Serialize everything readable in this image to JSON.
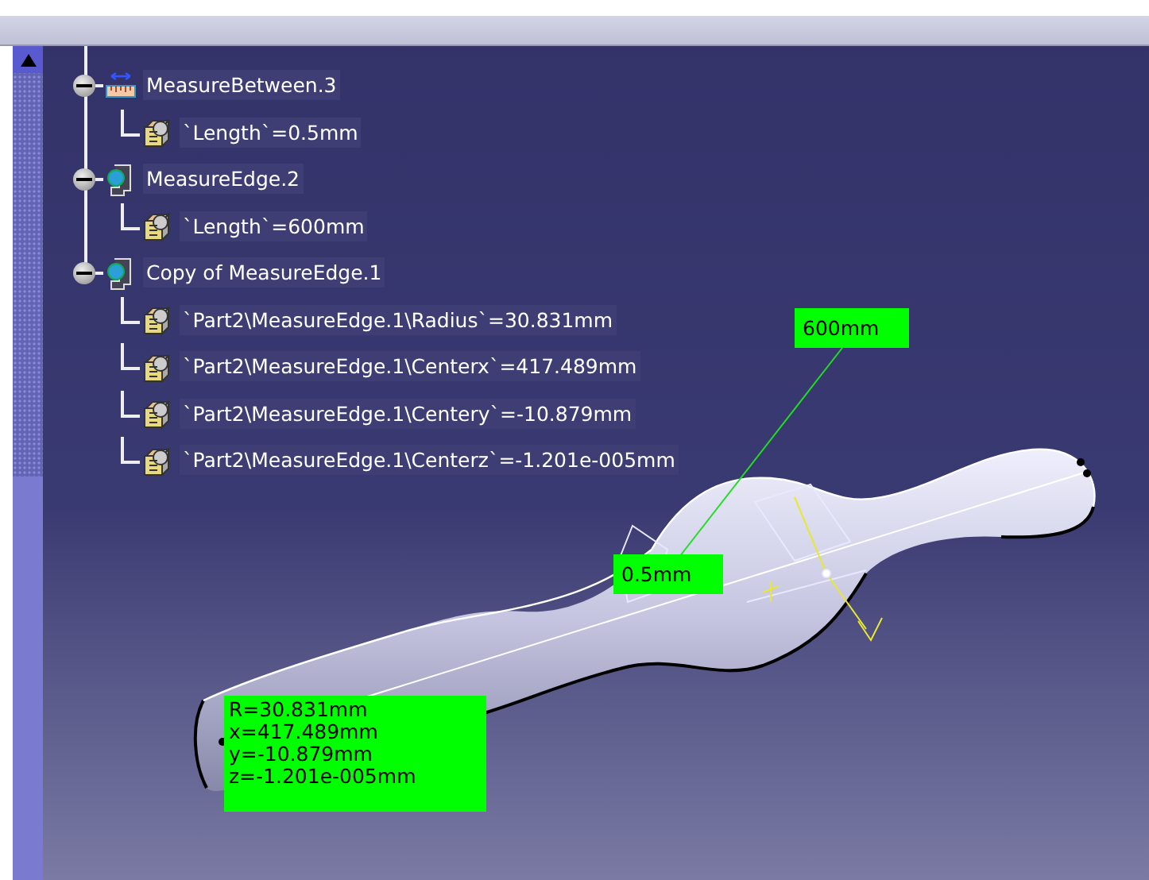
{
  "tree": [
    {
      "label": "MeasureBetween.3",
      "kind": "measure-between",
      "expanded": true,
      "children": [
        {
          "label": "`Length`=0.5mm"
        }
      ]
    },
    {
      "label": "MeasureEdge.2",
      "kind": "measure-edge",
      "expanded": true,
      "children": [
        {
          "label": "`Length`=600mm"
        }
      ]
    },
    {
      "label": "Copy of MeasureEdge.1",
      "kind": "measure-edge",
      "expanded": true,
      "children": [
        {
          "label": "`Part2\\MeasureEdge.1\\Radius`=30.831mm"
        },
        {
          "label": "`Part2\\MeasureEdge.1\\Centerx`=417.489mm"
        },
        {
          "label": "`Part2\\MeasureEdge.1\\Centery`=-10.879mm"
        },
        {
          "label": "`Part2\\MeasureEdge.1\\Centerz`=-1.201e-005mm"
        }
      ]
    }
  ],
  "labels": [
    {
      "kind": "single",
      "text": "600mm"
    },
    {
      "kind": "single",
      "text": "0.5mm"
    },
    {
      "kind": "multi",
      "lines": [
        "R=30.831mm",
        "x=417.489mm",
        "y=-10.879mm",
        "z=-1.201e-005mm"
      ]
    }
  ]
}
